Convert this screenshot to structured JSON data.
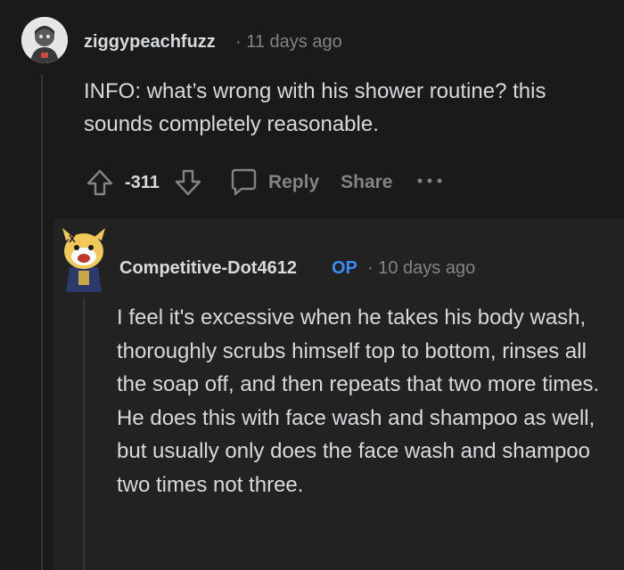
{
  "comment": {
    "username": "ziggypeachfuzz",
    "meta": "· 11 days ago",
    "body": "INFO: what’s wrong with his shower routine? this sounds completely reasonable.",
    "score": "-311",
    "reply_label": "Reply",
    "share_label": "Share",
    "more_label": "···",
    "icons": [
      "upvote-icon",
      "downvote-icon",
      "comment-icon",
      "more-icon"
    ]
  },
  "reply": {
    "username": "Competitive-Dot4612",
    "badge": "OP",
    "meta": "· 10 days ago",
    "body": "I feel it's excessive when he takes his body wash, thoroughly scrubs himself top to bottom, rinses all the soap off, and then repeats that two more times. He does this with face wash and shampoo as well, but usually only does the face wash and shampoo two times not three."
  },
  "colors": {
    "background": "#1a1a1b",
    "reply_background": "#222223",
    "text": "#d7dadc",
    "muted": "#818384",
    "op_badge": "#3b8cf5"
  }
}
